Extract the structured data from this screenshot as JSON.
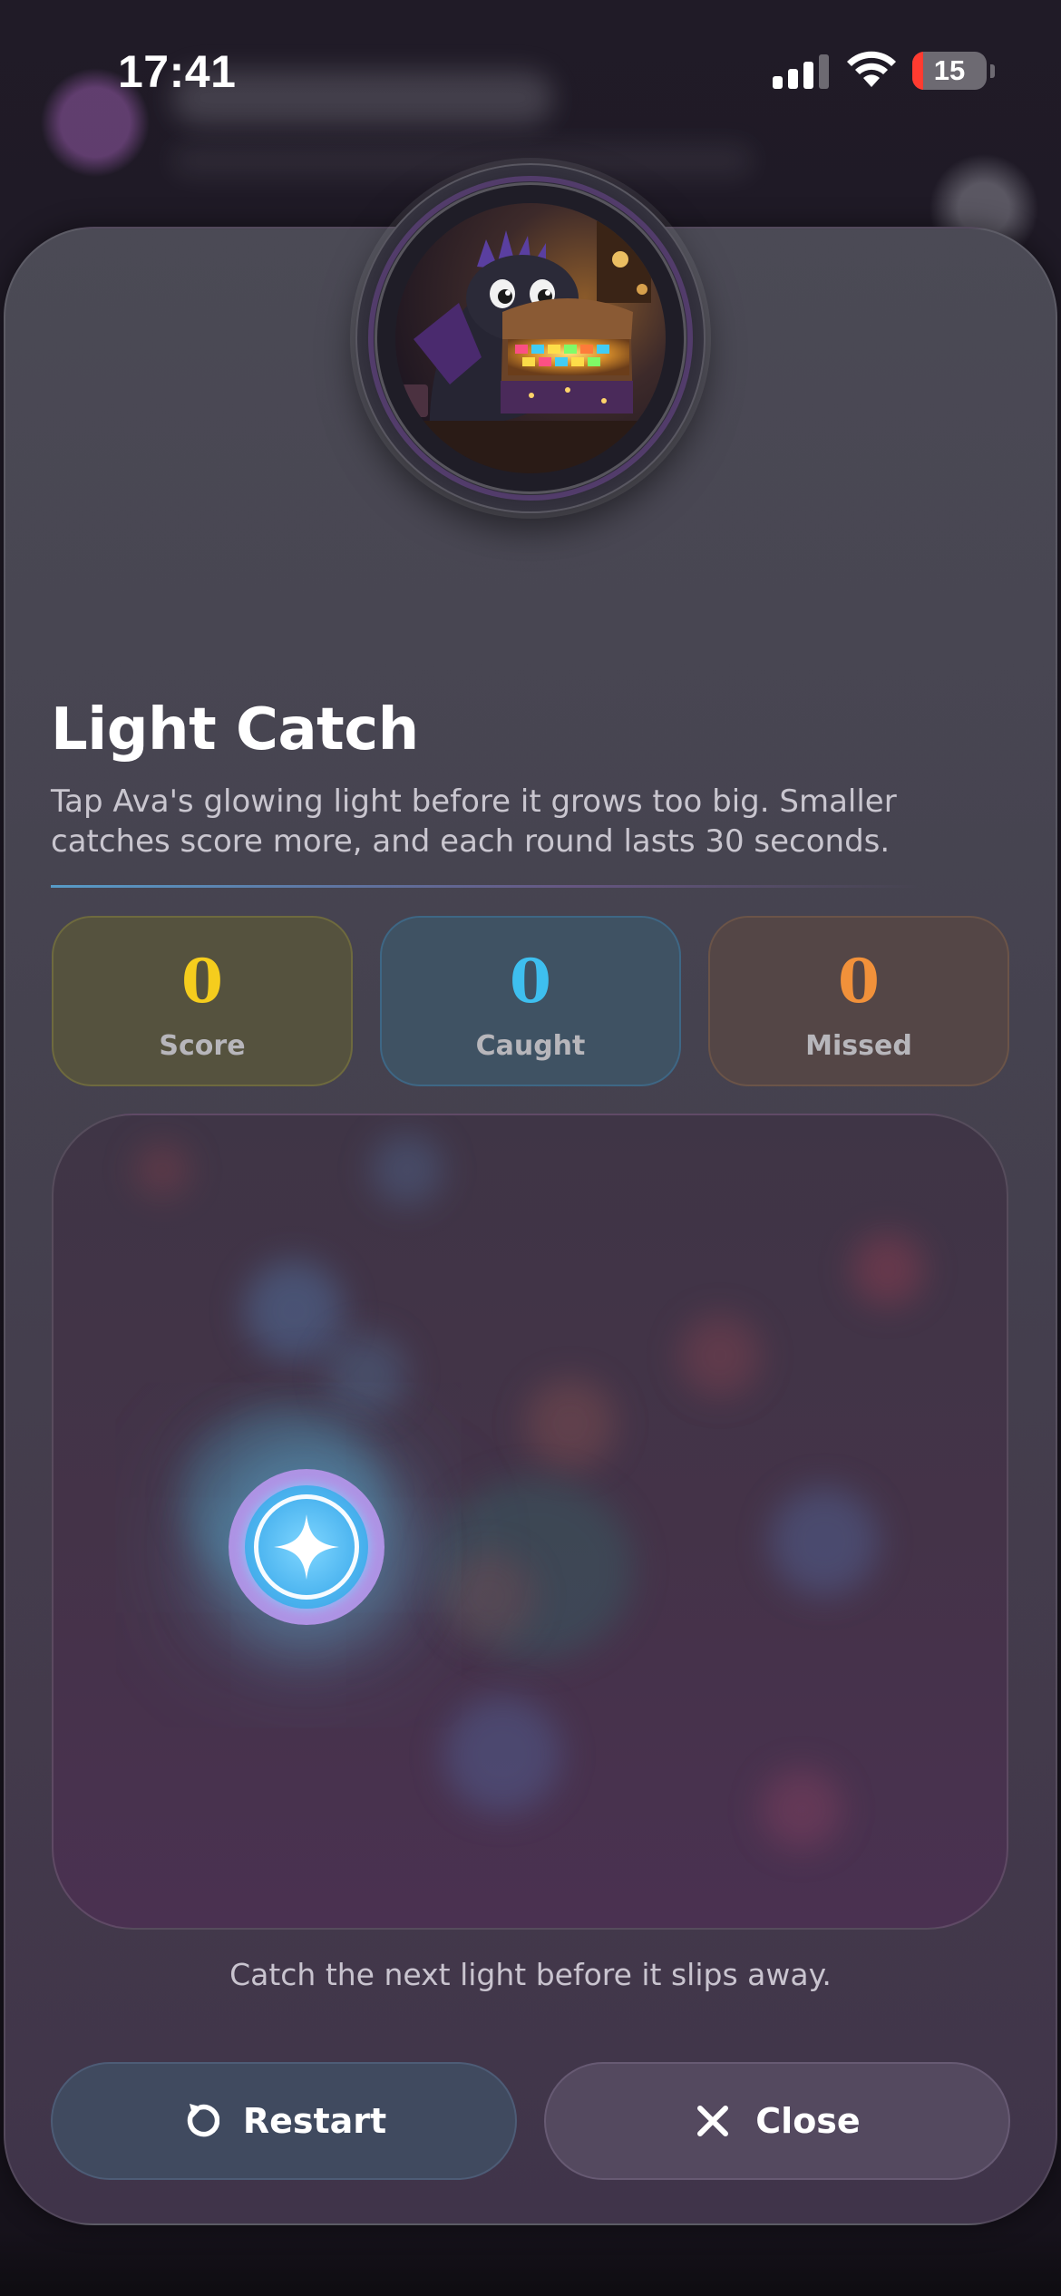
{
  "status_bar": {
    "time": "17:41",
    "battery": "15",
    "battery_level_percent": 15,
    "icons": [
      "signal-icon",
      "wifi-icon",
      "battery-icon"
    ]
  },
  "modal": {
    "avatar_name": "avatar",
    "title": "Light Catch",
    "description": "Tap Ava's glowing light before it grows too big. Smaller catches score more, and each round lasts 30 seconds."
  },
  "stats": [
    {
      "value": "0",
      "label": "Score",
      "color": "#f5cd1d"
    },
    {
      "value": "0",
      "label": "Caught",
      "color": "#3ebfef"
    },
    {
      "value": "0",
      "label": "Missed",
      "color": "#f1913a"
    }
  ],
  "game": {
    "target_icon": "sparkle-icon",
    "hint": "Catch the next light before it slips away."
  },
  "buttons": {
    "restart": {
      "label": "Restart",
      "icon": "restart-icon"
    },
    "close": {
      "label": "Close",
      "icon": "close-icon"
    }
  }
}
